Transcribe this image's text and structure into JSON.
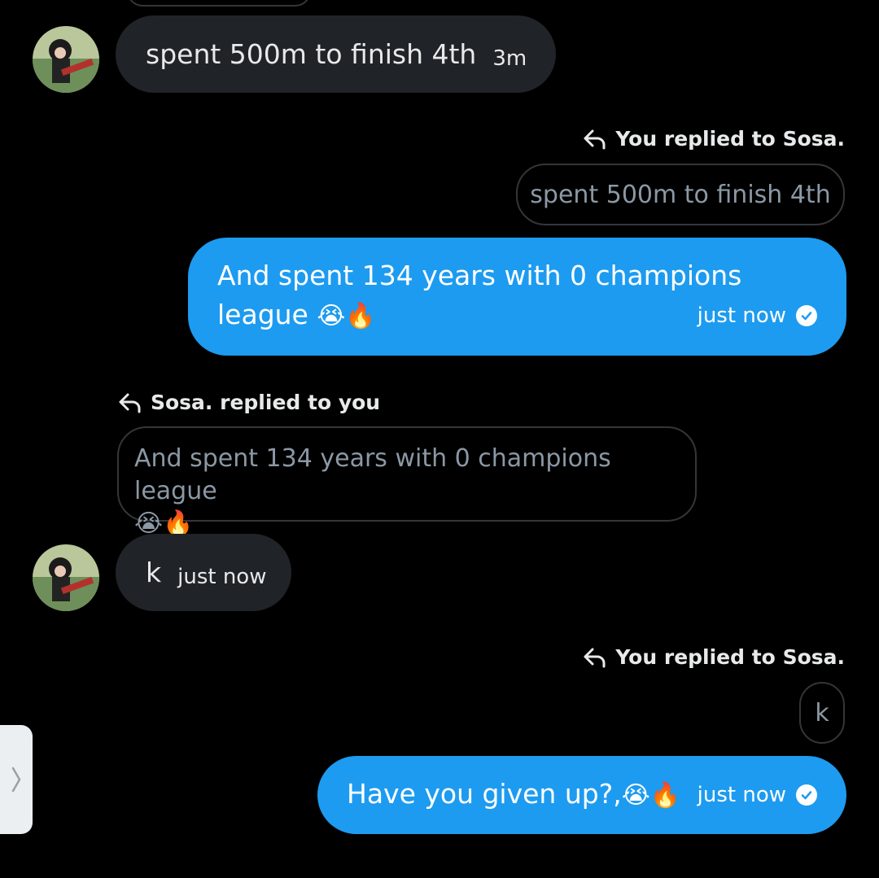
{
  "messages": {
    "m1": {
      "text": "spent 500m to finish 4th",
      "time": "3m"
    },
    "r1": {
      "label": "You replied to Sosa.",
      "quote": "spent 500m to finish 4th",
      "text_line1": "And spent 134 years with 0 champions",
      "text_line2": "league",
      "emoji": "😭🔥",
      "time": "just now"
    },
    "r2": {
      "label": "Sosa. replied to you",
      "quote_line1": "And spent 134 years with 0 champions league",
      "quote_emoji": "😭🔥",
      "text": "k",
      "time": "just now"
    },
    "r3": {
      "label": "You replied to Sosa.",
      "quote": "k",
      "text": "Have you given up?,",
      "emoji": "😭🔥",
      "time": "just now"
    }
  },
  "colors": {
    "background": "#000000",
    "outgoing_bubble": "#1d9bf0",
    "incoming_bubble": "#202327",
    "quote_border": "#333639"
  },
  "icons": [
    "reply-arrow-icon",
    "sent-check-icon",
    "chevron-right-icon"
  ]
}
